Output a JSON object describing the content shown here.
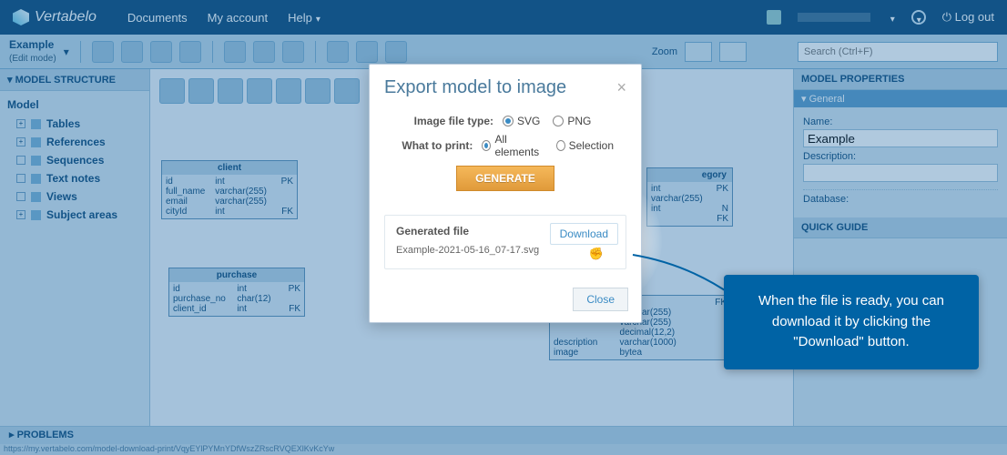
{
  "brand": "Vertabelo",
  "topnav": {
    "documents": "Documents",
    "account": "My account",
    "help": "Help",
    "logout": "Log out"
  },
  "model": {
    "name": "Example",
    "mode": "(Edit mode)"
  },
  "zoom_label": "Zoom",
  "search_placeholder": "Search (Ctrl+F)",
  "leftpanel": {
    "title": "MODEL STRUCTURE",
    "root": "Model",
    "items": [
      "Tables",
      "References",
      "Sequences",
      "Text notes",
      "Views",
      "Subject areas"
    ]
  },
  "problems_label": "PROBLEMS",
  "status_url": "https://my.vertabelo.com/model-download-print/VqyEYlPYMnYDfWszZRscRVQEXlKvKcYw",
  "rightpanel": {
    "title": "MODEL PROPERTIES",
    "general": "General",
    "name_label": "Name:",
    "name_value": "Example",
    "description_label": "Description:",
    "database_label": "Database:",
    "quickguide": "QUICK GUIDE"
  },
  "erm": {
    "client": {
      "name": "client",
      "rows": [
        [
          "id",
          "int",
          "PK"
        ],
        [
          "full_name",
          "varchar(255)",
          ""
        ],
        [
          "email",
          "varchar(255)",
          ""
        ],
        [
          "cityId",
          "int",
          "FK"
        ]
      ]
    },
    "purchase": {
      "name": "purchase",
      "rows": [
        [
          "id",
          "int",
          "PK"
        ],
        [
          "purchase_no",
          "char(12)",
          ""
        ],
        [
          "client_id",
          "int",
          "FK"
        ]
      ]
    },
    "category": {
      "name_partial": "egory",
      "rows": [
        [
          "",
          "int",
          "PK"
        ],
        [
          "",
          "varchar(255)",
          ""
        ],
        [
          "",
          "int",
          "N FK"
        ]
      ]
    },
    "product_bottom": {
      "rows": [
        [
          "",
          "",
          "FK"
        ],
        [
          "",
          "varchar(255)",
          ""
        ],
        [
          "",
          "varchar(255)",
          ""
        ],
        [
          "",
          "decimal(12,2)",
          ""
        ],
        [
          "description",
          "varchar(1000)",
          ""
        ],
        [
          "image",
          "bytea",
          ""
        ]
      ]
    }
  },
  "modal": {
    "title": "Export model to image",
    "filetype_label": "Image file type:",
    "opt_svg": "SVG",
    "opt_png": "PNG",
    "print_label": "What to print:",
    "opt_all": "All elements",
    "opt_sel": "Selection",
    "generate": "GENERATE",
    "generated_title": "Generated file",
    "filename": "Example-2021-05-16_07-17.svg",
    "download": "Download",
    "close": "Close"
  },
  "callout_text": "When the file is ready, you can download it by clicking the \"Download\" button."
}
